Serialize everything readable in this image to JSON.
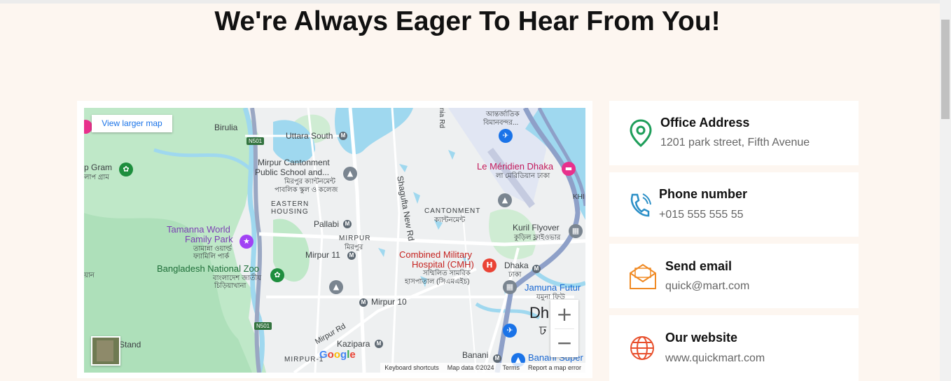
{
  "section": {
    "heading": "We're Always Eager To Hear From You!"
  },
  "map": {
    "larger_map_link": "View larger map",
    "zoom_in": "+",
    "zoom_out": "−",
    "google_logo": "Google",
    "footer": {
      "shortcuts": "Keyboard shortcuts",
      "map_data": "Map data ©2024",
      "terms": "Terms",
      "report": "Report a map error"
    },
    "labels": {
      "birulia": "Birulia",
      "uttara_south": "Uttara South",
      "mirpur_cant_1": "Mirpur Cantonment",
      "mirpur_cant_2": "Public School and...",
      "mirpur_cant_bn1": "মিরপুর ক্যান্টনমেন্ট",
      "mirpur_cant_bn2": "পাবলিক স্কুল ও কলেজ",
      "eastern_housing_1": "EASTERN",
      "eastern_housing_2": "HOUSING",
      "pallabi": "Pallabi",
      "mirpur": "MIRPUR",
      "mirpur_bn": "মিরপুর",
      "mirpur_11": "Mirpur 11",
      "mirpur_10": "Mirpur 10",
      "tamanna_1": "Tamanna World",
      "tamanna_2": "Family Park",
      "tamanna_bn1": "তামান্না ওয়ার্ল্ড",
      "tamanna_bn2": "ফ্যামিলি পার্ক",
      "zoo": "Bangladesh National Zoo",
      "zoo_bn1": "বাংলাদেশ জাতীয়",
      "zoo_bn2": "চিড়িয়াখানা",
      "cmh_1": "Combined Military",
      "cmh_2": "Hospital (CMH)",
      "cmh_bn1": "সম্মিলিত সামরিক",
      "cmh_bn2": "হাসপাতাল (সিএমএইচ)",
      "cantonment": "CANTONMENT",
      "cantonment_bn": "ক্যান্টনমেন্ট",
      "shagufta": "Shagufta New Rd",
      "lemeridien": "Le Méridien Dhaka",
      "lemeridien_bn": "লা মেরিডিয়ান ঢাকা",
      "airport_bn1": "আন্তর্জাতিক",
      "airport_bn2": "বিমানবন্দর...",
      "kuril": "Kuril Flyover",
      "kuril_bn": "কুড়িল ফ্লাইওভার",
      "dhaka": "Dhaka",
      "dhaka_bn": "ঢাকা",
      "dhaka_big": "Dh",
      "dhaka_big_bn": "ঢ",
      "jamuna": "Jamuna Futur",
      "jamuna_bn": "যমুনা ফিউ",
      "kazipara": "Kazipara",
      "mirpur_rd": "Mirpur Rd",
      "mirpur_1": "MIRPUR-1",
      "banani": "Banani",
      "banani_super": "Banani Super",
      "stand": "Stand",
      "gram": "p Gram",
      "gram_bn": "লাপ গ্রাম",
      "nia_rd": "nia Rd",
      "khi": "KHI",
      "left_bn": "য়ান",
      "n501a": "N501",
      "n501b": "N501"
    }
  },
  "contacts": [
    {
      "title": "Office Address",
      "value": "1201 park street, Fifth Avenue",
      "icon": "location-pin-icon",
      "color": "#1e9e5a"
    },
    {
      "title": "Phone number",
      "value": "+015 555 555 55",
      "icon": "phone-icon",
      "color": "#2b8fc7"
    },
    {
      "title": "Send email",
      "value": "quick@mart.com",
      "icon": "envelope-icon",
      "color": "#f08a24"
    },
    {
      "title": "Our website",
      "value": "www.quickmart.com",
      "icon": "globe-icon",
      "color": "#e8502d"
    }
  ]
}
